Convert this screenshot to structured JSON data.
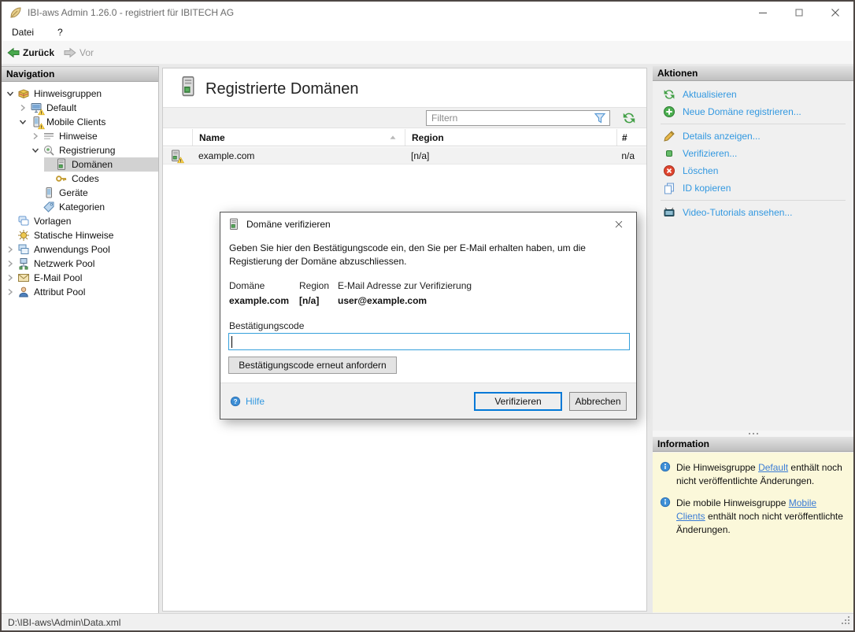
{
  "window": {
    "title": "IBI-aws Admin 1.26.0 - registriert für IBITECH AG",
    "status_path": "D:\\IBI-aws\\Admin\\Data.xml"
  },
  "menu": {
    "file": "Datei",
    "help": "?"
  },
  "toolbar": {
    "back": "Zurück",
    "forward": "Vor"
  },
  "navigation": {
    "header": "Navigation",
    "items": [
      {
        "label": "Hinweisgruppen",
        "expanded": true
      },
      {
        "label": "Default",
        "expanded": false
      },
      {
        "label": "Mobile Clients",
        "expanded": true
      },
      {
        "label": "Hinweise",
        "expanded": false
      },
      {
        "label": "Registrierung",
        "expanded": true
      },
      {
        "label": "Domänen",
        "selected": true
      },
      {
        "label": "Codes"
      },
      {
        "label": "Geräte"
      },
      {
        "label": "Kategorien"
      },
      {
        "label": "Vorlagen"
      },
      {
        "label": "Statische Hinweise"
      },
      {
        "label": "Anwendungs Pool",
        "expanded": false
      },
      {
        "label": "Netzwerk Pool",
        "expanded": false
      },
      {
        "label": "E-Mail Pool",
        "expanded": false
      },
      {
        "label": "Attribut Pool",
        "expanded": false
      }
    ]
  },
  "main": {
    "title": "Registrierte Domänen",
    "filter_placeholder": "Filtern",
    "table": {
      "col_name": "Name",
      "col_region": "Region",
      "col_count": "#",
      "rows": [
        {
          "name": "example.com",
          "region": "[n/a]",
          "count": "n/a"
        }
      ]
    }
  },
  "actions": {
    "header": "Aktionen",
    "items": [
      "Aktualisieren",
      "Neue Domäne registrieren...",
      "Details anzeigen...",
      "Verifizieren...",
      "Löschen",
      "ID kopieren",
      "Video-Tutorials ansehen..."
    ]
  },
  "information": {
    "header": "Information",
    "items": [
      {
        "pre": "Die Hinweisgruppe ",
        "link": "Default",
        "post": " enthält noch nicht veröffentlichte Änderungen."
      },
      {
        "pre": "Die mobile Hinweisgruppe ",
        "link": "Mobile Clients",
        "post": " enthält noch nicht veröffentlichte Änderungen."
      }
    ]
  },
  "dialog": {
    "title": "Domäne verifizieren",
    "body": "Geben Sie hier den Bestätigungscode ein, den Sie per E-Mail erhalten haben, um die Registierung der Domäne abzuschliessen.",
    "domain_label": "Domäne",
    "region_label": "Region",
    "email_label": "E-Mail Adresse zur Verifizierung",
    "domain_value": "example.com",
    "region_value": "[n/a]",
    "email_value": "user@example.com",
    "code_label": "Bestätigungscode",
    "code_value": "",
    "resend_button": "Bestätigungscode erneut anfordern",
    "help_link": "Hilfe",
    "verify_button": "Verifizieren",
    "cancel_button": "Abbrechen"
  },
  "colors": {
    "action_link": "#3298e0",
    "info_link": "#3a7bd5",
    "info_bg": "#fbf8da",
    "selection": "#d2d2d2",
    "focus_border": "#0078d7",
    "warning_yellow": "#ffd54f"
  }
}
